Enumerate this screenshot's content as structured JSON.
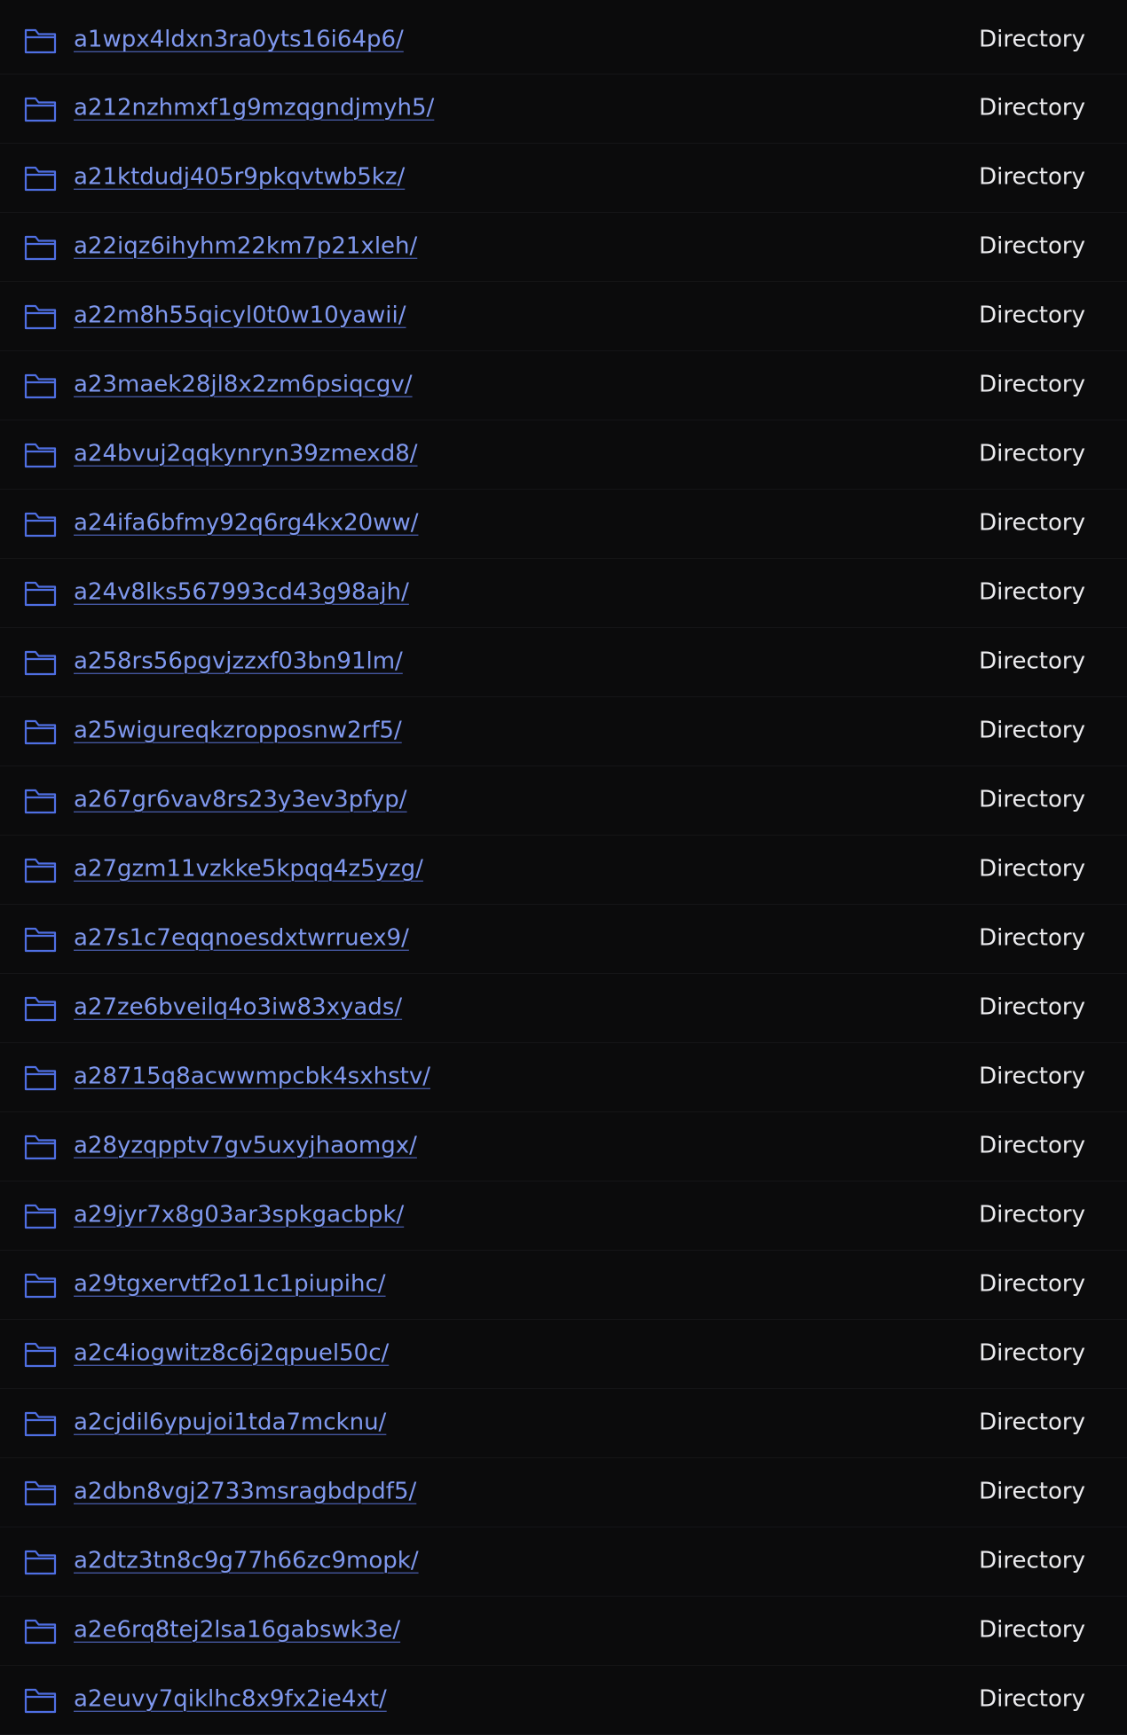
{
  "entries": [
    {
      "name": "a1wpx4ldxn3ra0yts16i64p6/",
      "type": "Directory"
    },
    {
      "name": "a212nzhmxf1g9mzqgndjmyh5/",
      "type": "Directory"
    },
    {
      "name": "a21ktdudj405r9pkqvtwb5kz/",
      "type": "Directory"
    },
    {
      "name": "a22iqz6ihyhm22km7p21xleh/",
      "type": "Directory"
    },
    {
      "name": "a22m8h55qicyl0t0w10yawii/",
      "type": "Directory"
    },
    {
      "name": "a23maek28jl8x2zm6psiqcgv/",
      "type": "Directory"
    },
    {
      "name": "a24bvuj2qqkynryn39zmexd8/",
      "type": "Directory"
    },
    {
      "name": "a24ifa6bfmy92q6rg4kx20ww/",
      "type": "Directory"
    },
    {
      "name": "a24v8lks567993cd43g98ajh/",
      "type": "Directory"
    },
    {
      "name": "a258rs56pgvjzzxf03bn91lm/",
      "type": "Directory"
    },
    {
      "name": "a25wigureqkzropposnw2rf5/",
      "type": "Directory"
    },
    {
      "name": "a267gr6vav8rs23y3ev3pfyp/",
      "type": "Directory"
    },
    {
      "name": "a27gzm11vzkke5kpqq4z5yzg/",
      "type": "Directory"
    },
    {
      "name": "a27s1c7eqqnoesdxtwrruex9/",
      "type": "Directory"
    },
    {
      "name": "a27ze6bveilq4o3iw83xyads/",
      "type": "Directory"
    },
    {
      "name": "a28715q8acwwmpcbk4sxhstv/",
      "type": "Directory"
    },
    {
      "name": "a28yzqpptv7gv5uxyjhaomgx/",
      "type": "Directory"
    },
    {
      "name": "a29jyr7x8g03ar3spkgacbpk/",
      "type": "Directory"
    },
    {
      "name": "a29tgxervtf2o11c1piupihc/",
      "type": "Directory"
    },
    {
      "name": "a2c4iogwitz8c6j2qpuel50c/",
      "type": "Directory"
    },
    {
      "name": "a2cjdil6ypujoi1tda7mcknu/",
      "type": "Directory"
    },
    {
      "name": "a2dbn8vgj2733msragbdpdf5/",
      "type": "Directory"
    },
    {
      "name": "a2dtz3tn8c9g77h66zc9mopk/",
      "type": "Directory"
    },
    {
      "name": "a2e6rq8tej2lsa16gabswk3e/",
      "type": "Directory"
    },
    {
      "name": "a2euvy7qiklhc8x9fx2ie4xt/",
      "type": "Directory"
    }
  ],
  "icons": {
    "entry_icon": "folder-icon"
  },
  "colors": {
    "background": "#0b0b0c",
    "link": "#7f98ee",
    "icon": "#4f6fe3",
    "type_text": "#ececef"
  }
}
